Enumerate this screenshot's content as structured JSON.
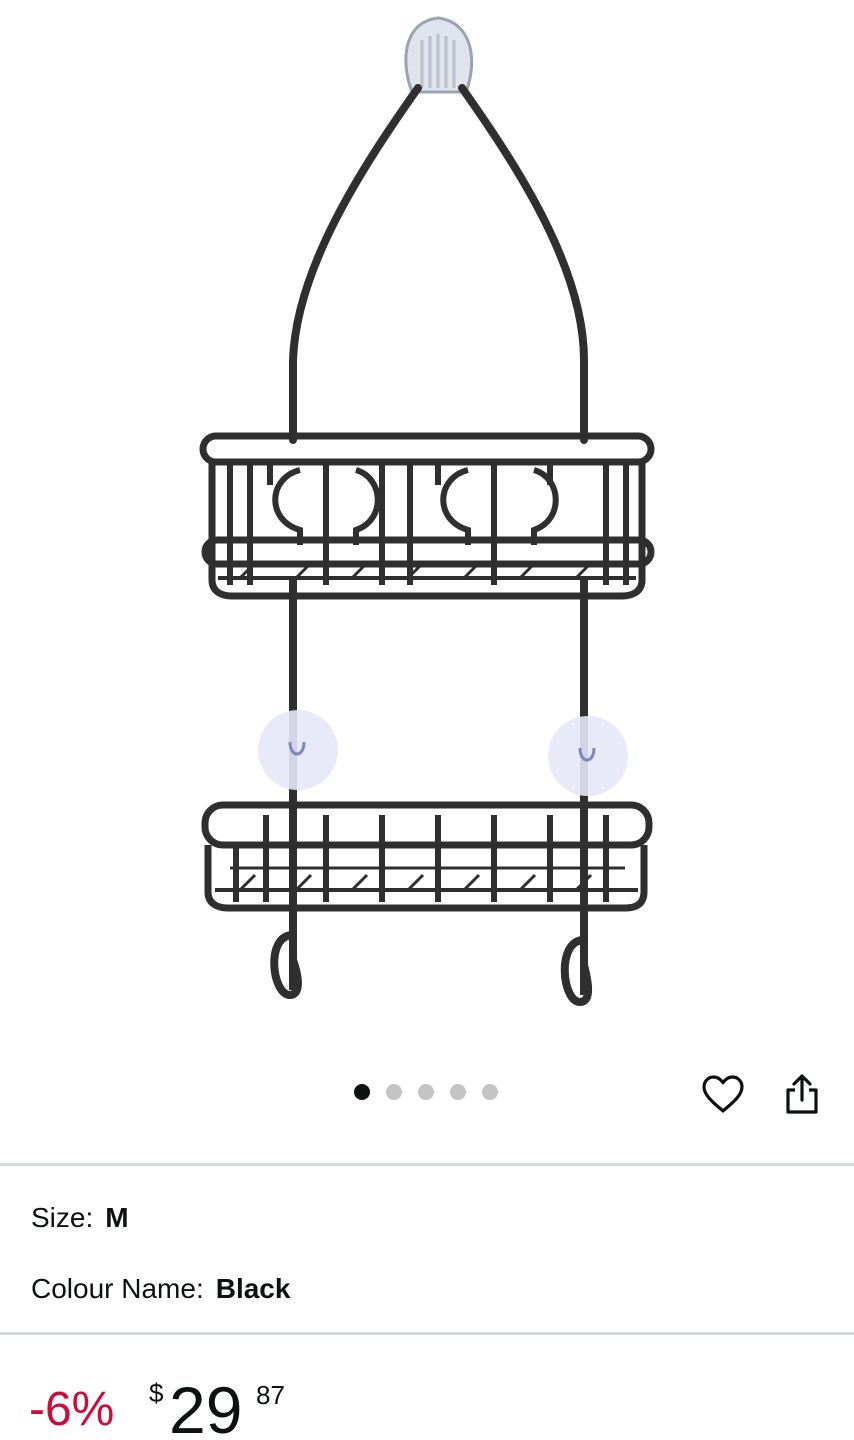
{
  "product_image": {
    "alt": "Black two-tier shower caddy with suction cups and hooks"
  },
  "carousel": {
    "total_images": 5,
    "active_index": 0
  },
  "actions": {
    "wishlist_icon": "heart-outline-icon",
    "share_icon": "share-icon"
  },
  "variations": {
    "size_label": "Size:",
    "size_value": "M",
    "colour_label": "Colour Name:",
    "colour_value": "Black"
  },
  "price": {
    "discount": "-6%",
    "currency": "$",
    "whole": "29",
    "fraction": "87"
  },
  "colors": {
    "discount": "#cc0c39",
    "text": "#0f1111",
    "dot_active": "#0f1111",
    "dot_inactive": "#c4c4c4",
    "divider": "#d5d9d9"
  }
}
